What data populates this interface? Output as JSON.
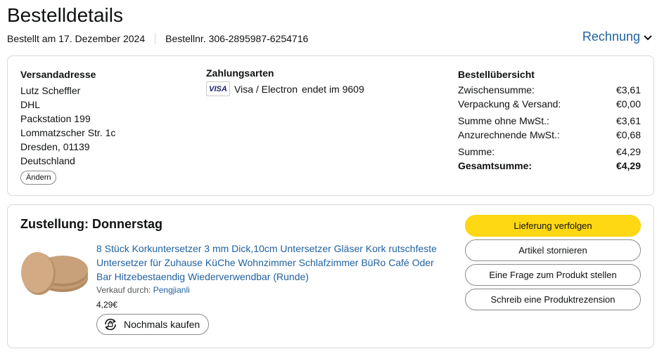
{
  "page": {
    "title": "Bestelldetails",
    "ordered_on": "Bestellt am 17. Dezember 2024",
    "order_number": "Bestellnr. 306-2895987-6254716",
    "invoice_label": "Rechnung"
  },
  "shipping": {
    "heading": "Versandadresse",
    "lines": [
      "Lutz Scheffler",
      "DHL",
      "Packstation 199",
      "Lommatzscher Str. 1c",
      "Dresden, 01139",
      "Deutschland"
    ],
    "change_label": "Ändern"
  },
  "payment": {
    "heading": "Zahlungsarten",
    "card_logo": "VISA",
    "card_name": "Visa / Electron",
    "card_ending": "endet im 9609"
  },
  "summary": {
    "heading": "Bestellübersicht",
    "rows": [
      {
        "label": "Zwischensumme:",
        "value": "€3,61"
      },
      {
        "label": "Verpackung & Versand:",
        "value": "€0,00"
      },
      {
        "label": "Summe ohne MwSt.:",
        "value": "€3,61"
      },
      {
        "label": "Anzurechnende MwSt.:",
        "value": "€0,68"
      },
      {
        "label": "Summe:",
        "value": "€4,29"
      },
      {
        "label": "Gesamtsumme:",
        "value": "€4,29"
      }
    ]
  },
  "delivery": {
    "title": "Zustellung: Donnerstag",
    "product_title": "8 Stück Korkuntersetzer 3 mm Dick,10cm Untersetzer Gläser Kork rutschfeste Untersetzer für Zuhause KüChe Wohnzimmer Schlafzimmer BüRo Café Oder Bar Hitzebestaendig Wiederverwendbar (Runde)",
    "seller_label": "Verkauf durch:",
    "seller_name": "Pengjianli",
    "price": "4,29€",
    "rebuy_label": "Nochmals kaufen",
    "actions": {
      "track": "Lieferung verfolgen",
      "cancel": "Artikel stornieren",
      "question": "Eine Frage zum Produkt stellen",
      "review": "Schreib eine Produktrezension"
    }
  },
  "colors": {
    "link": "#2162a1",
    "primary_button": "#ffd814",
    "border": "#d5d9d9",
    "cork": "#c8a07a"
  }
}
